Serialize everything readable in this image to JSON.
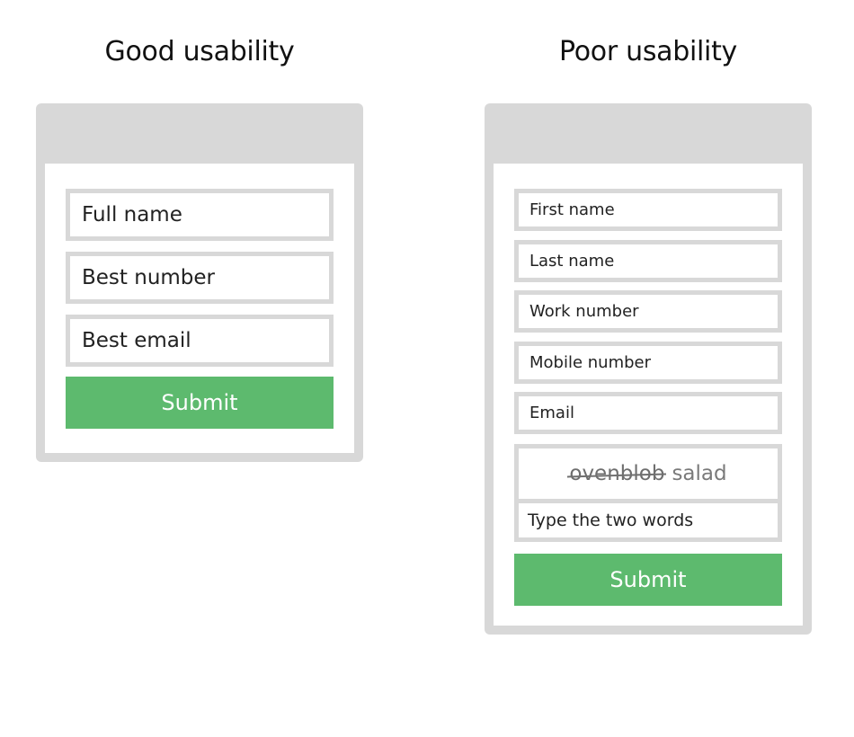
{
  "good_form": {
    "title": "Good usability",
    "fields": [
      {
        "placeholder": "Full name"
      },
      {
        "placeholder": "Best number"
      },
      {
        "placeholder": "Best email"
      }
    ],
    "submit_label": "Submit"
  },
  "poor_form": {
    "title": "Poor usability",
    "fields": [
      {
        "placeholder": "First name"
      },
      {
        "placeholder": "Last name"
      },
      {
        "placeholder": "Work number"
      },
      {
        "placeholder": "Mobile number"
      },
      {
        "placeholder": "Email"
      }
    ],
    "captcha": {
      "word_1": "ovenblob",
      "word_2": "salad",
      "input_placeholder": "Type the two words"
    },
    "submit_label": "Submit"
  },
  "colors": {
    "frame": "#d8d8d8",
    "submit_background": "#5dba6e",
    "submit_text": "#ffffff"
  }
}
